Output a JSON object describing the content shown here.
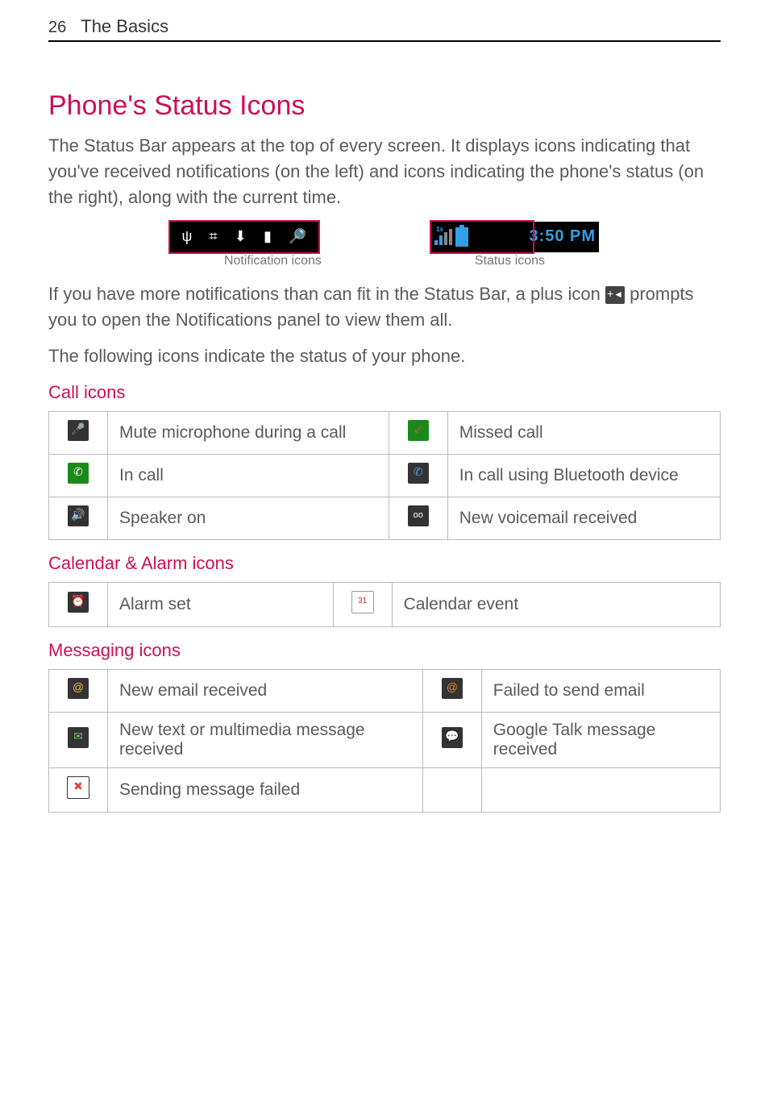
{
  "page_header": {
    "number": "26",
    "section": "The Basics"
  },
  "title": "Phone's Status Icons",
  "intro": "The Status Bar appears at the top of every screen. It displays icons indicating that you've received notifications (on the left) and icons indicating the phone's status (on the right), along with the current time.",
  "status_bar": {
    "time": "3:50 PM",
    "signal_label": "1x",
    "notification_caption": "Notification icons",
    "status_caption": "Status icons"
  },
  "plus_para_a": "If you have more notifications than can fit in the Status Bar, a plus icon ",
  "plus_para_b": " prompts you to open the Notifications panel to view them all.",
  "body2": "The following icons indicate the status of your phone.",
  "sections": {
    "call": {
      "heading": "Call icons",
      "rows": [
        {
          "left_icon": "mic-mute-icon",
          "left_sym": "🎤",
          "left_sym_cls": "red",
          "left_label": "Mute microphone during a call",
          "right_icon": "missed-call-icon",
          "right_sym": "↙",
          "right_sym_cls": "red",
          "right_bg": "green",
          "right_label": "Missed call"
        },
        {
          "left_icon": "in-call-icon",
          "left_sym": "✆",
          "left_sym_cls": "",
          "left_bg": "green",
          "left_label": "In call",
          "right_icon": "bt-call-icon",
          "right_sym": "✆",
          "right_sym_cls": "blue",
          "right_label": "In call using Bluetooth device"
        },
        {
          "left_icon": "speaker-icon",
          "left_sym": "🔊",
          "left_sym_cls": "",
          "left_label": "Speaker on",
          "right_icon": "voicemail-icon",
          "right_sym": "oo",
          "right_sym_cls": "",
          "right_label": "New voicemail received"
        }
      ]
    },
    "calendar": {
      "heading": "Calendar & Alarm icons",
      "rows": [
        {
          "left_icon": "alarm-icon",
          "left_sym": "⏰",
          "left_sym_cls": "",
          "left_label": "Alarm set",
          "right_icon": "calendar-icon",
          "right_sym": "31",
          "right_sym_cls": "",
          "right_label": "Calendar event"
        }
      ]
    },
    "messaging": {
      "heading": "Messaging icons",
      "rows": [
        {
          "left_icon": "email-icon",
          "left_sym": "@",
          "left_sym_cls": "yellow",
          "left_label": "New email received",
          "right_icon": "email-fail-icon",
          "right_sym": "@",
          "right_sym_cls": "orange",
          "right_label": "Failed to send email"
        },
        {
          "left_icon": "sms-icon",
          "left_sym": "✉",
          "left_sym_cls": "greenish",
          "left_label": "New text or multimedia message received",
          "right_icon": "talk-icon",
          "right_sym": "💬",
          "right_sym_cls": "",
          "right_label": "Google Talk message received"
        },
        {
          "left_icon": "sms-fail-icon",
          "left_sym": "✖",
          "left_sym_cls": "red",
          "left_label": "Sending message failed",
          "right_icon": "",
          "right_sym": "",
          "right_sym_cls": "",
          "right_label": ""
        }
      ]
    }
  }
}
